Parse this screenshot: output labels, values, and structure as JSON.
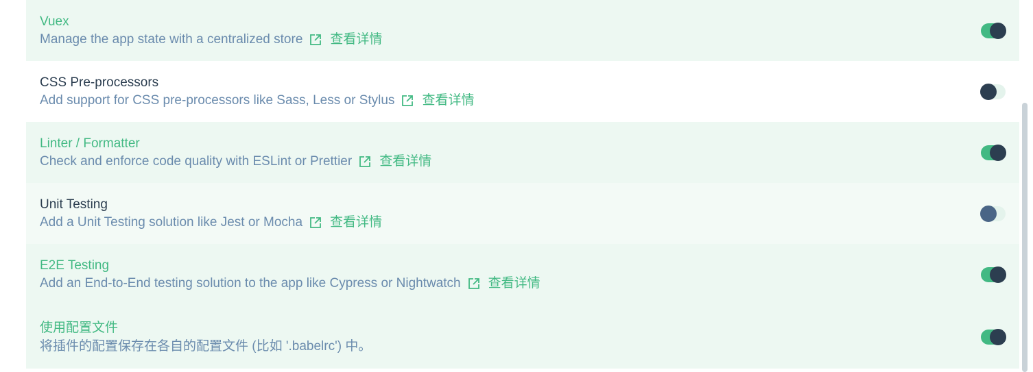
{
  "more_label": "查看详情",
  "colors": {
    "accent": "#42b983",
    "text_dark": "#2c3e50",
    "desc": "#6a8bad",
    "selected_bg": "#edf8f2"
  },
  "features": [
    {
      "title": "Vuex",
      "description": "Manage the app state with a centralized store",
      "enabled": true,
      "has_link": true
    },
    {
      "title": "CSS Pre-processors",
      "description": "Add support for CSS pre-processors like Sass, Less or Stylus",
      "enabled": false,
      "has_link": true
    },
    {
      "title": "Linter / Formatter",
      "description": "Check and enforce code quality with ESLint or Prettier",
      "enabled": true,
      "has_link": true
    },
    {
      "title": "Unit Testing",
      "description": "Add a Unit Testing solution like Jest or Mocha",
      "enabled": false,
      "has_link": true
    },
    {
      "title": "E2E Testing",
      "description": "Add an End-to-End testing solution to the app like Cypress or Nightwatch",
      "enabled": true,
      "has_link": true
    },
    {
      "title": "使用配置文件",
      "description": "将插件的配置保存在各自的配置文件 (比如 '.babelrc') 中。",
      "enabled": true,
      "has_link": false
    }
  ]
}
